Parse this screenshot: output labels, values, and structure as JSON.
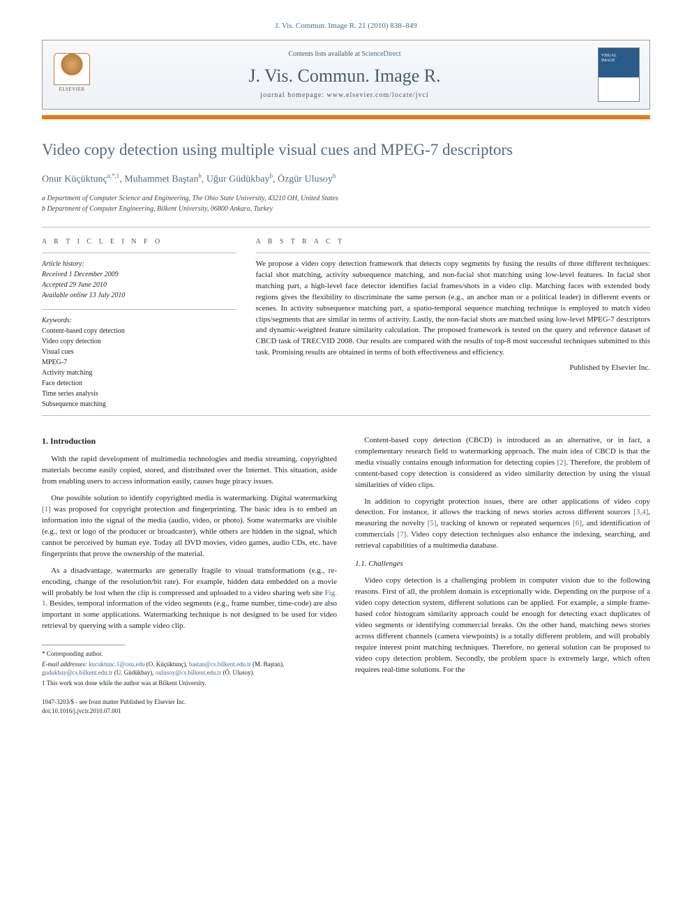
{
  "header": {
    "citation": "J. Vis. Commun. Image R. 21 (2010) 838–849",
    "contents_prefix": "Contents lists available at ",
    "contents_link": "ScienceDirect",
    "journal_title": "J. Vis. Commun. Image R.",
    "homepage_label": "journal homepage: www.elsevier.com/locate/jvci",
    "elsevier": "ELSEVIER"
  },
  "paper": {
    "title": "Video copy detection using multiple visual cues and MPEG-7 descriptors",
    "authors_html": "Onur Küçüktunç",
    "author1": "Onur Küçüktunç",
    "author1_sup": "a,*,1",
    "author2": "Muhammet Baştan",
    "author2_sup": "b",
    "author3": "Uğur Güdükbay",
    "author3_sup": "b",
    "author4": "Özgür Ulusoy",
    "author4_sup": "b",
    "aff_a": "a Department of Computer Science and Engineering, The Ohio State University, 43210 OH, United States",
    "aff_b": "b Department of Computer Engineering, Bilkent University, 06800 Ankara, Turkey"
  },
  "info": {
    "heading": "A R T I C L E   I N F O",
    "history_label": "Article history:",
    "received": "Received 1 December 2009",
    "accepted": "Accepted 29 June 2010",
    "online": "Available online 13 July 2010",
    "keywords_label": "Keywords:",
    "keywords": [
      "Content-based copy detection",
      "Video copy detection",
      "Visual cues",
      "MPEG-7",
      "Activity matching",
      "Face detection",
      "Time series analysis",
      "Subsequence matching"
    ]
  },
  "abstract": {
    "heading": "A B S T R A C T",
    "text": "We propose a video copy detection framework that detects copy segments by fusing the results of three different techniques: facial shot matching, activity subsequence matching, and non-facial shot matching using low-level features. In facial shot matching part, a high-level face detector identifies facial frames/shots in a video clip. Matching faces with extended body regions gives the flexibility to discriminate the same person (e.g., an anchor man or a political leader) in different events or scenes. In activity subsequence matching part, a spatio-temporal sequence matching technique is employed to match video clips/segments that are similar in terms of activity. Lastly, the non-facial shots are matched using low-level MPEG-7 descriptors and dynamic-weighted feature similarity calculation. The proposed framework is tested on the query and reference dataset of CBCD task of TRECVID 2008. Our results are compared with the results of top-8 most successful techniques submitted to this task. Promising results are obtained in terms of both effectiveness and efficiency.",
    "publisher": "Published by Elsevier Inc."
  },
  "body": {
    "sec1_title": "1. Introduction",
    "p1": "With the rapid development of multimedia technologies and media streaming, copyrighted materials become easily copied, stored, and distributed over the Internet. This situation, aside from enabling users to access information easily, causes huge piracy issues.",
    "p2a": "One possible solution to identify copyrighted media is watermarking. Digital watermarking ",
    "p2_ref1": "[1]",
    "p2b": " was proposed for copyright protection and fingerprinting. The basic idea is to embed an information into the signal of the media (audio, video, or photo). Some watermarks are visible (e.g., text or logo of the producer or broadcaster), while others are hidden in the signal, which cannot be perceived by human eye. Today all DVD movies, video games, audio CDs, etc. have fingerprints that prove the ownership of the material.",
    "p3a": "As a disadvantage, watermarks are generally fragile to visual transformations (e.g., re-encoding, change of the resolution/bit rate). For example, hidden data embedded on a movie will probably be lost when the clip is compressed and uploaded to a video sharing web site ",
    "p3_fig": "Fig. 1",
    "p3b": ". Besides, temporal information of the video segments (e.g., frame number, time-code) are also important in some applications. Watermarking technique is not designed to be used for video retrieval by querying with a sample video clip.",
    "p4a": "Content-based copy detection (CBCD) is introduced as an alternative, or in fact, a complementary research field to watermarking approach. The main idea of CBCD is that the media visually contains enough information for detecting copies ",
    "p4_ref2": "[2]",
    "p4b": ". Therefore, the problem of content-based copy detection is considered as video similarity detection by using the visual similarities of video clips.",
    "p5a": "In addition to copyright protection issues, there are other applications of video copy detection. For instance, it allows the tracking of news stories across different sources ",
    "p5_ref34": "[3,4]",
    "p5b": ", measuring the novelty ",
    "p5_ref5": "[5]",
    "p5c": ", tracking of known or repeated sequences ",
    "p5_ref6": "[6]",
    "p5d": ", and identification of commercials ",
    "p5_ref7": "[7]",
    "p5e": ". Video copy detection techniques also enhance the indexing, searching, and retrieval capabilities of a multimedia database.",
    "sec11_title": "1.1. Challenges",
    "p6": "Video copy detection is a challenging problem in computer vision due to the following reasons. First of all, the problem domain is exceptionally wide. Depending on the purpose of a video copy detection system, different solutions can be applied. For example, a simple frame-based color histogram similarity approach could be enough for detecting exact duplicates of video segments or identifying commercial breaks. On the other hand, matching news stories across different channels (camera viewpoints) is a totally different problem, and will probably require interest point matching techniques. Therefore, no general solution can be proposed to video copy detection problem. Secondly, the problem space is extremely large, which often requires real-time solutions. For the"
  },
  "footnotes": {
    "corr": "* Corresponding author.",
    "emails_label": "E-mail addresses:",
    "e1": "kucuktunc.1@osu.edu",
    "n1": "(O. Küçüktunç),",
    "e2": "bastan@cs.bilkent.edu.tr",
    "n2": "(M. Baştan),",
    "e3": "gudukbay@cs.bilkent.edu.tr",
    "n3": "(U. Güdükbay),",
    "e4": "oulusoy@cs.bilkent.edu.tr",
    "n4": "(Ö. Ulusoy).",
    "note1": "1 This work was done while the author was at Bilkent University.",
    "copyright": "1047-3203/$ - see front matter Published by Elsevier Inc.",
    "doi": "doi:10.1016/j.jvcir.2010.07.001"
  }
}
